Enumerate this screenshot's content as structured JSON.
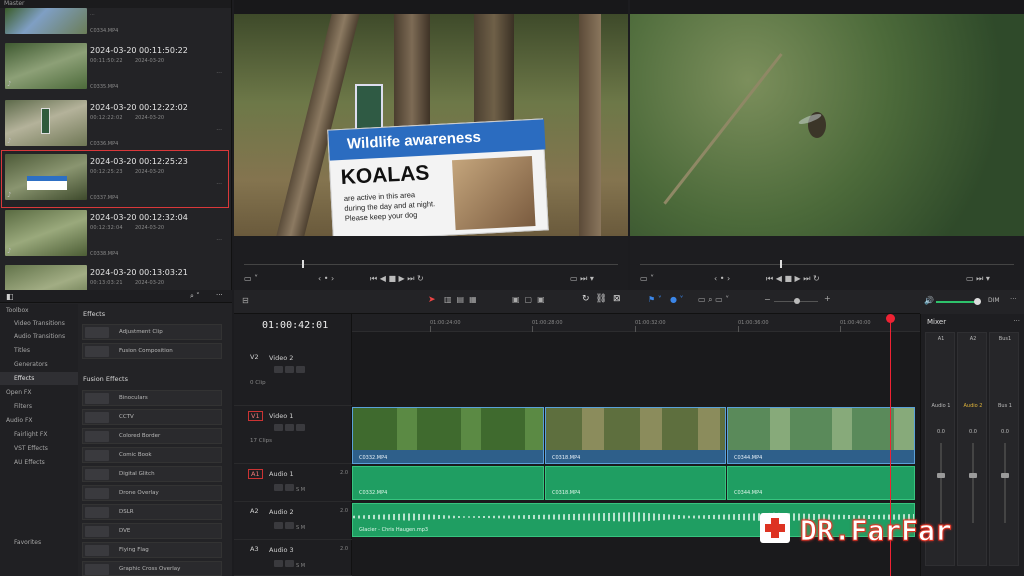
{
  "pool": {
    "header": "Master",
    "clips": [
      {
        "title": "",
        "tc1": "",
        "tc2": "",
        "file": "C0334.MP4"
      },
      {
        "title": "2024-03-20  00:11:50:22",
        "tc1": "00:11:50:22",
        "tc2": "2024-03-20",
        "file": "C0335.MP4"
      },
      {
        "title": "2024-03-20  00:12:22:02",
        "tc1": "00:12:22:02",
        "tc2": "2024-03-20",
        "file": "C0336.MP4"
      },
      {
        "title": "2024-03-20  00:12:25:23",
        "tc1": "00:12:25:23",
        "tc2": "2024-03-20",
        "file": "C0337.MP4"
      },
      {
        "title": "2024-03-20  00:12:32:04",
        "tc1": "00:12:32:04",
        "tc2": "2024-03-20",
        "file": "C0338.MP4"
      },
      {
        "title": "2024-03-20  00:13:03:21",
        "tc1": "00:13:03:21",
        "tc2": "2024-03-20",
        "file": ""
      }
    ]
  },
  "viewer_left": {
    "sign_banner": "Wildlife awareness",
    "sign_title": "KOALAS",
    "sign_text": [
      "are active in this area",
      "during the day and at night.",
      "Please keep your dog"
    ]
  },
  "effects": {
    "tree": [
      "Toolbox",
      "Video Transitions",
      "Audio Transitions",
      "Titles",
      "Generators",
      "Effects",
      "Open FX",
      "Filters",
      "Audio FX",
      "Fairlight FX",
      "VST Effects",
      "AU Effects"
    ],
    "favorites": "Favorites",
    "section1": "Effects",
    "items1": [
      "Adjustment Clip",
      "Fusion Composition"
    ],
    "section2": "Fusion Effects",
    "items2": [
      "Binoculars",
      "CCTV",
      "Colored Border",
      "Comic Book",
      "Digital Glitch",
      "Drone Overlay",
      "DSLR",
      "DVE",
      "Flying Flag",
      "Graphic Cross Overlay"
    ]
  },
  "timeline": {
    "timecode": "01:00:42:01",
    "ruler": [
      "01:00:24:00",
      "01:00:28:00",
      "01:00:32:00",
      "01:00:36:00",
      "01:00:40:00"
    ],
    "tracks": [
      {
        "id": "V2",
        "name": "Video 2",
        "count": "0 Clip"
      },
      {
        "id": "V1",
        "name": "Video 1",
        "count": "17 Clips"
      },
      {
        "id": "A1",
        "name": "Audio 1",
        "level": "2.0"
      },
      {
        "id": "A2",
        "name": "Audio 2",
        "level": "2.0"
      },
      {
        "id": "A3",
        "name": "Audio 3",
        "level": "2.0"
      }
    ],
    "video_clips": [
      "C0332.MP4",
      "C0318.MP4",
      "C0344.MP4"
    ],
    "audio_clips": [
      "C0332.MP4",
      "C0318.MP4",
      "C0344.MP4"
    ],
    "music_clip": "Glacier - Chris Haugen.mp3",
    "dim": "DIM"
  },
  "mixer": {
    "title": "Mixer",
    "channels": [
      "A1",
      "A2",
      "Bus1"
    ],
    "lower": [
      "Audio 1",
      "Audio 2",
      "Bus 1"
    ],
    "db": [
      "0.0",
      "0.0",
      "0.0"
    ]
  },
  "watermark": "DR.FarFar",
  "colors": {
    "accent_red": "#e2232f",
    "video_clip": "#2e5f8a",
    "audio_clip": "#1f9e62",
    "selection": "#d9383a"
  }
}
